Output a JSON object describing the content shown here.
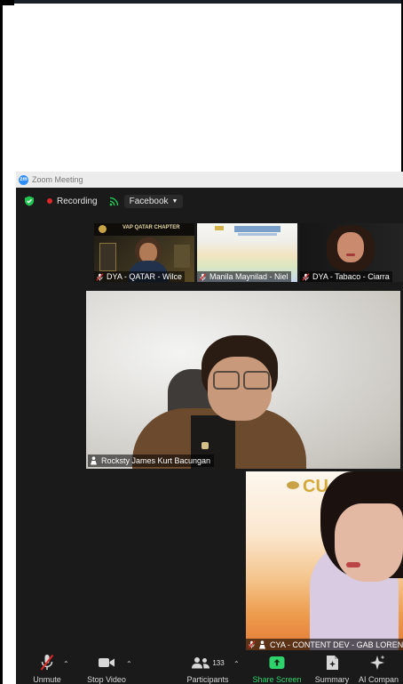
{
  "window": {
    "title": "Zoom Meeting"
  },
  "topbar": {
    "recording_label": "Recording",
    "live_label": "Facebook"
  },
  "thumbnails": [
    {
      "name": "DYA - QATAR - Wilce",
      "banner": "VAP QATAR CHAPTER"
    },
    {
      "name": "Manila Maynilad - Niel"
    },
    {
      "name": "DYA - Tabaco - Ciarra"
    }
  ],
  "main_speaker": {
    "name": "Rocksty James Kurt Bacungan"
  },
  "second_speaker": {
    "name": "CYA - CONTENT DEV - GAB LORENO",
    "banner_text": "CU"
  },
  "toolbar": {
    "unmute": "Unmute",
    "stop_video": "Stop Video",
    "participants": "Participants",
    "participant_count": "133",
    "share_screen": "Share Screen",
    "summary": "Summary",
    "ai_companion": "AI Compan"
  },
  "colors": {
    "recording": "#e02828",
    "share_screen": "#2ed36b",
    "mic_muted": "#e02828",
    "zoom_blue": "#2d8cff"
  }
}
